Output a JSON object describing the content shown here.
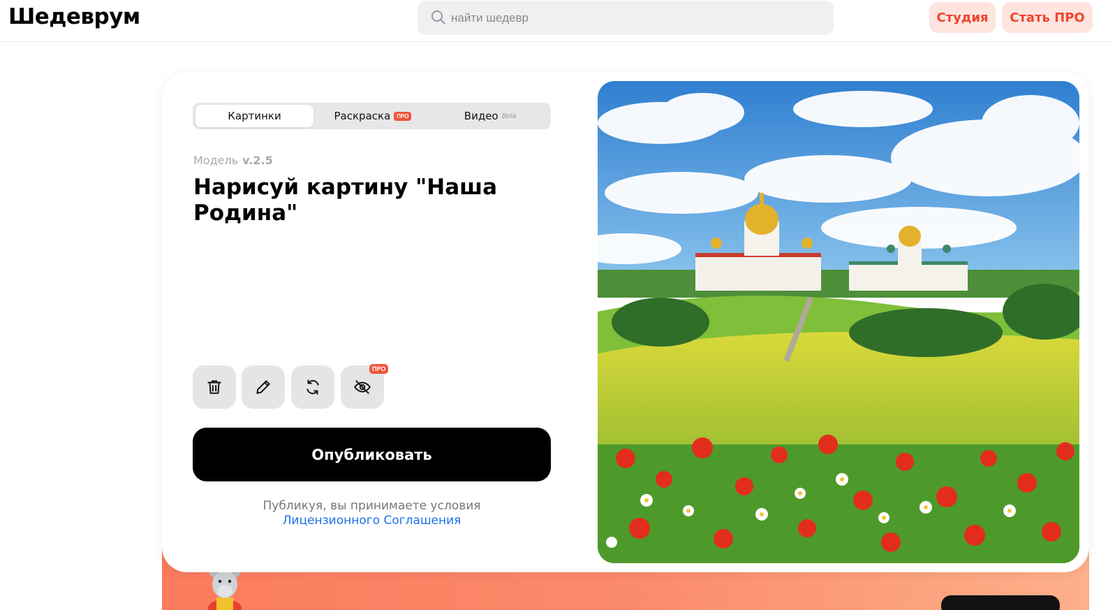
{
  "header": {
    "logo": "Шедеврум",
    "search_placeholder": "найти шедевр",
    "studio_label": "Студия",
    "pro_label": "Стать ПРО"
  },
  "tabs": [
    {
      "label": "Картинки",
      "active": true
    },
    {
      "label": "Раскраска",
      "badge": "ПРО"
    },
    {
      "label": "Видео",
      "badge": "Beta"
    }
  ],
  "model": {
    "label": "Модель",
    "version": "v.2.5"
  },
  "prompt": "Нарисуй картину \"Наша Родина\"",
  "actions": [
    {
      "icon": "trash-icon"
    },
    {
      "icon": "pencil-icon"
    },
    {
      "icon": "refresh-icon"
    },
    {
      "icon": "eye-off-icon",
      "badge": "ПРО"
    }
  ],
  "publish_label": "Опубликовать",
  "terms": {
    "text": "Публикуя, вы принимаете условия",
    "link": "Лицензионного Соглашения"
  },
  "colors": {
    "accent": "#f0432b",
    "accent_bg": "#fde4df",
    "link": "#1a73e8"
  }
}
